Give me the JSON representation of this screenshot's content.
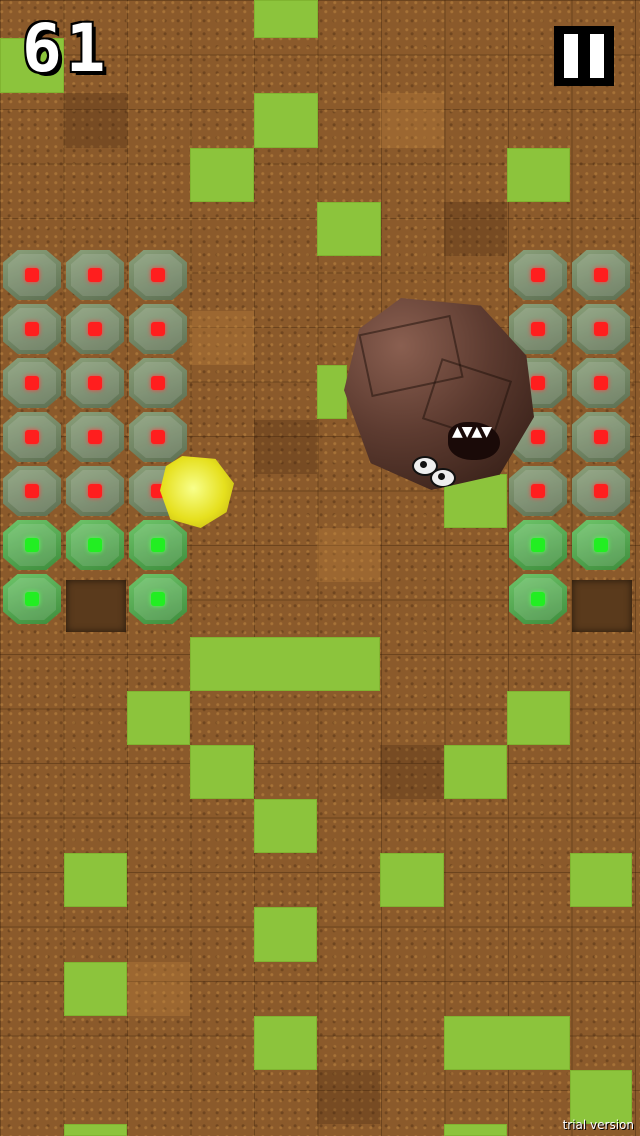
{
  "hud": {
    "score": "61",
    "pause_icon": "pause-icon"
  },
  "footer": {
    "trial_label": "trial version"
  },
  "colors": {
    "grass": "#8cc43c",
    "dirt": "#8b5a2b",
    "block_red_led": "#ff1e1e",
    "block_green_led": "#22ee22",
    "gem": "#e6e01e"
  },
  "board": {
    "player": "gem",
    "enemy": "rock-monster"
  }
}
